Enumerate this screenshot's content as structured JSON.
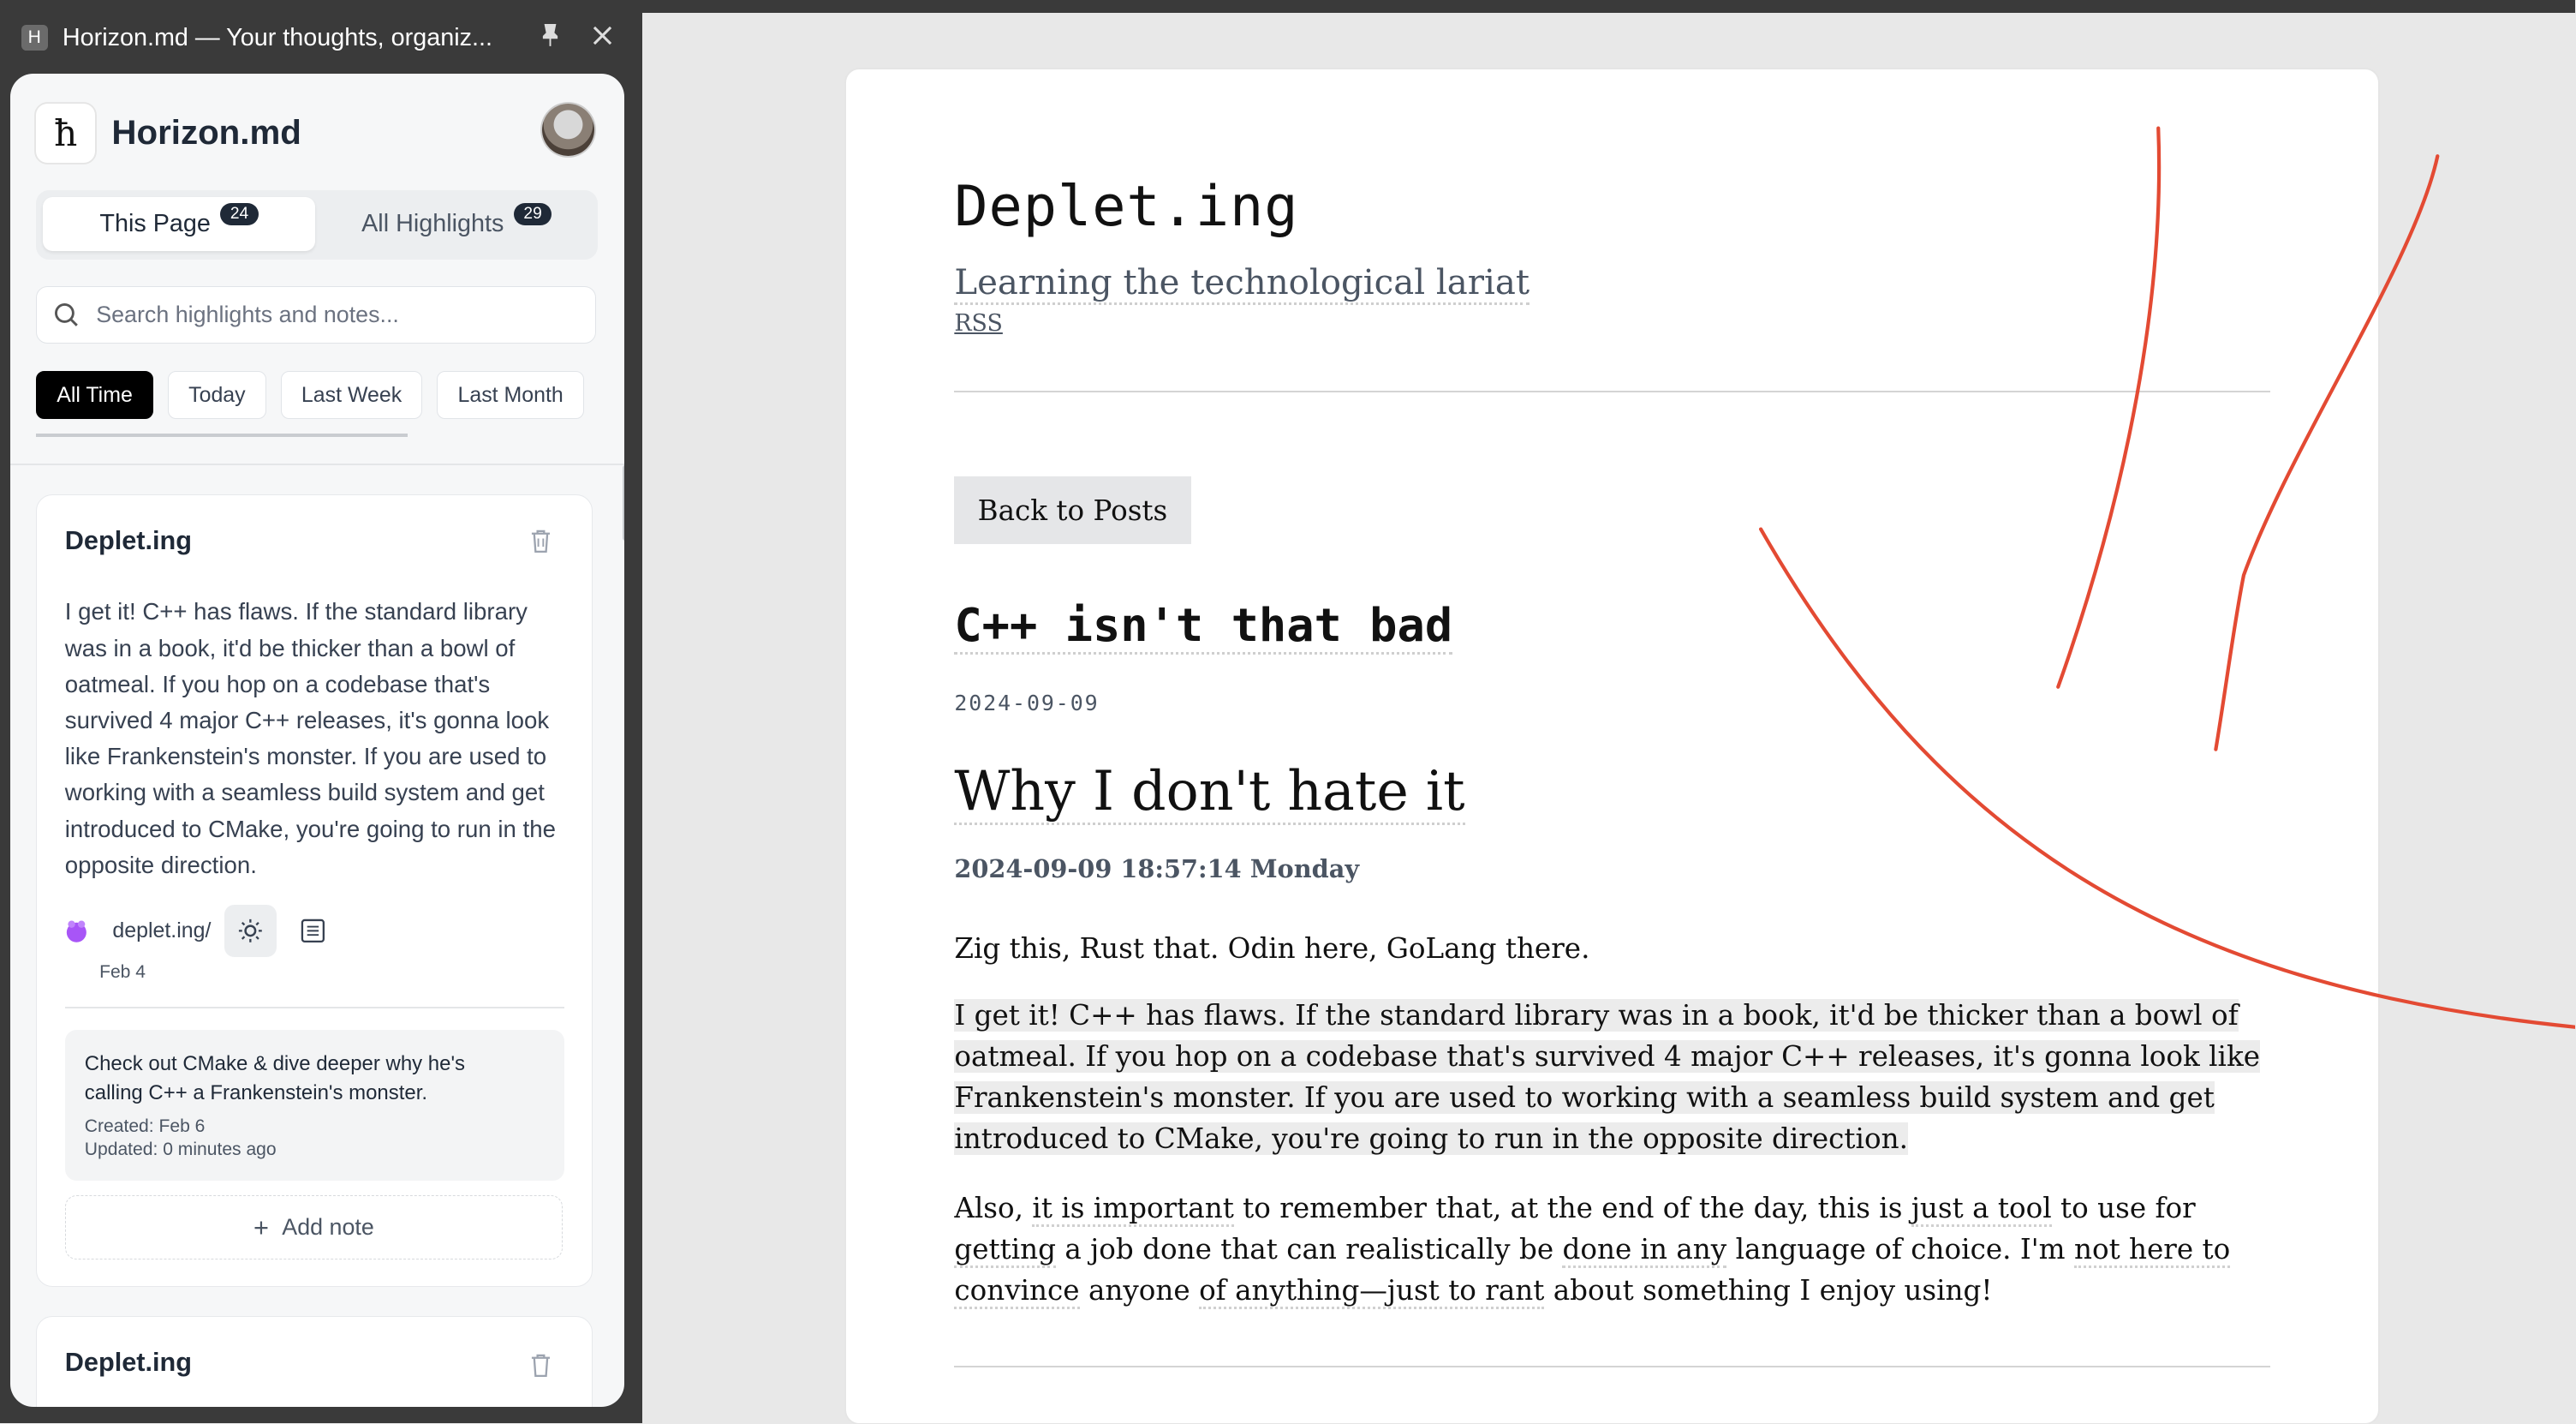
{
  "window": {
    "favicon_letter": "H",
    "title": "Horizon.md — Your thoughts, organiz..."
  },
  "sidebar": {
    "logo_glyph": "ħ",
    "brand": "Horizon.md",
    "tabs": [
      {
        "label": "This Page",
        "count": "24"
      },
      {
        "label": "All Highlights",
        "count": "29"
      }
    ],
    "search_placeholder": "Search highlights and notes...",
    "filters": [
      "All Time",
      "Today",
      "Last Week",
      "Last Month"
    ],
    "cards": [
      {
        "title": "Deplet.ing",
        "text": "I get it! C++ has flaws. If the standard library was in a book, it'd be thicker than a bowl of oatmeal. If you hop on a codebase that's survived 4 major C++ releases, it's gonna look like Frankenstein's monster. If you are used to working with a seamless build system and get introduced to CMake, you're going to run in the opposite direction.",
        "site": "deplet.ing/",
        "date": "Feb 4",
        "note": {
          "text": "Check out CMake & dive deeper why he's calling C++ a Frankenstein's monster.",
          "created": "Created: Feb 6",
          "updated": "Updated: 0 minutes ago"
        },
        "add_note": "Add note"
      },
      {
        "title": "Deplet.ing"
      }
    ]
  },
  "page": {
    "blog_title": "Deplet.ing",
    "tagline": "Learning the technological lariat",
    "rss": "RSS",
    "back_button": "Back to Posts",
    "post_title": "C++ isn't that bad",
    "post_date": "2024-09-09",
    "heading": "Why I don't hate it",
    "timestamp": "2024-09-09 18:57:14 Monday",
    "para1": "Zig this, Rust that. Odin here, GoLang there.",
    "para2_lines": [
      "I get it! C++ has flaws. If the standard library was in a book, it'd be thicker than a bowl of",
      "oatmeal. If you hop on a codebase that's survived 4 major C++ releases, it's gonna look like",
      "Frankenstein's monster. If you are used to working with a seamless build system and get",
      "introduced to CMake, you're going to run in the opposite direction."
    ],
    "para3": {
      "s1": "Also, ",
      "u1": "it is important",
      "s2": " to remember that, at the end of the day, this is ",
      "u2": "just a tool",
      "s3": " to use for ",
      "u3": "getting",
      "s4": " a job done that can realistically be ",
      "u4": "done in any",
      "s5": " language of choice. I'm ",
      "u5": "not here to convince",
      "s6": " anyone ",
      "u6": "of anything—just to rant",
      "s7": " about something I enjoy using!"
    }
  },
  "colors": {
    "ink": "#e34a33",
    "chrome": "#3a3a3a",
    "highlight": "#ececec"
  }
}
